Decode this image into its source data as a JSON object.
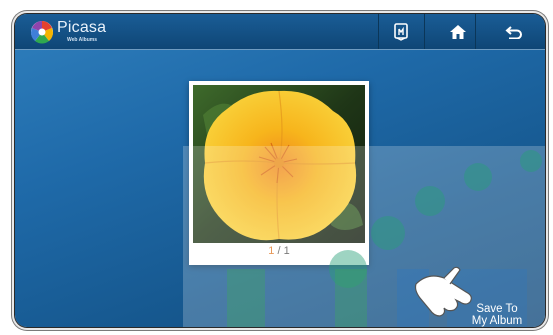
{
  "app": {
    "brand": "Picasa",
    "brand_sub": "Web Albums"
  },
  "toolbar": {
    "items": [
      {
        "name": "slideshow-button",
        "icon": "hand-photo-icon"
      },
      {
        "name": "home-button",
        "icon": "home-icon"
      },
      {
        "name": "back-button",
        "icon": "back-arrow-icon"
      }
    ]
  },
  "viewer": {
    "current": "1",
    "separator": " / ",
    "total": "1"
  },
  "action": {
    "save_label_line1": "Save To",
    "save_label_line2": "My Album"
  },
  "colors": {
    "accent": "#e07b2a",
    "topbar": "#1a5d96",
    "background": "#1f6aa9"
  }
}
